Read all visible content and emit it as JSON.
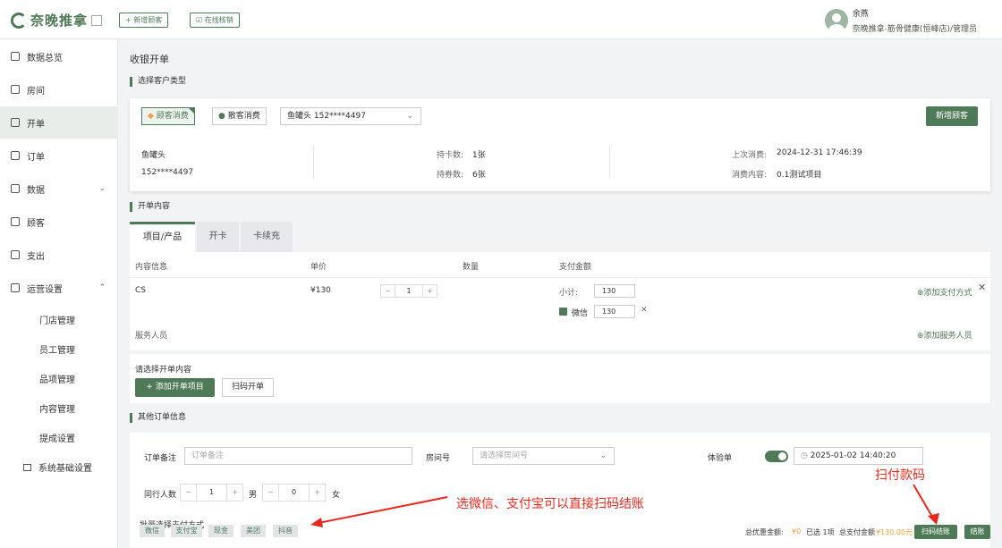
{
  "brand": {
    "name": "奈晚推拿"
  },
  "topbar": {
    "new_customer": "+ 新增顾客",
    "verify": "☑ 在线核销"
  },
  "user": {
    "name": "余燕",
    "store_role": "奈晚推拿-筋骨健康(恒峰店)/管理员"
  },
  "sidebar": {
    "items": [
      {
        "label": "数据总览"
      },
      {
        "label": "房间"
      },
      {
        "label": "开单"
      },
      {
        "label": "订单"
      },
      {
        "label": "数据"
      },
      {
        "label": "顾客"
      },
      {
        "label": "支出"
      },
      {
        "label": "运营设置"
      }
    ],
    "sub_items": [
      {
        "label": "门店管理"
      },
      {
        "label": "员工管理"
      },
      {
        "label": "品项管理"
      },
      {
        "label": "内容管理"
      },
      {
        "label": "提成设置"
      },
      {
        "label": "系统基础设置"
      }
    ]
  },
  "page": {
    "title": "收银开单"
  },
  "customer_section": {
    "title": "选择客户类型",
    "type_member": "顾客消费",
    "type_walkin": "散客消费",
    "selected_customer": "鱼罐头 152****4497",
    "new_button": "新增顾客",
    "name": "鱼罐头",
    "phone": "152****4497",
    "cards_label": "持卡数:",
    "cards_value": "1张",
    "coupons_label": "持券数:",
    "coupons_value": "6张",
    "last_label": "上次消费:",
    "last_value": "2024-12-31 17:46:39",
    "content_label": "消费内容:",
    "content_value": "0.1测试项目"
  },
  "order_section": {
    "title": "开单内容",
    "tabs": [
      "项目/产品",
      "开卡",
      "卡续充"
    ],
    "headers": [
      "内容信息",
      "单价",
      "数量",
      "支付金额"
    ],
    "row": {
      "name": "CS",
      "price": "¥130",
      "qty": "1",
      "subtotal_label": "小计:",
      "subtotal": "130",
      "pay_method": "微信",
      "pay_amount": "130",
      "add_payment": "⊕添加支付方式"
    },
    "staff_label": "服务人员",
    "add_staff": "⊕添加服务人员"
  },
  "add_section": {
    "title": "请选择开单内容",
    "add_item": "+ 添加开单项目",
    "scan_order": "扫码开单"
  },
  "other_section": {
    "title": "其他订单信息",
    "remark_label": "订单备注",
    "remark_placeholder": "订单备注",
    "room_label": "房间号",
    "room_placeholder": "请选择房间号",
    "trial_label": "体验单",
    "datetime": "2025-01-02 14:40:20",
    "companions_label": "同行人数",
    "male_count": "1",
    "male_label": "男",
    "female_count": "0",
    "female_label": "女",
    "batch_pay_label": "批量选择支付方式",
    "pay_options": [
      "微信",
      "支付宝",
      "现金",
      "美团",
      "抖音"
    ]
  },
  "footer": {
    "discount_label": "总优惠金额:",
    "discount_value": "¥0",
    "selected": "已选 1项",
    "total_label": "总支付金额",
    "total_value": "¥130.00元",
    "scan_pay": "扫码结账",
    "checkout": "结账"
  },
  "annotations": {
    "scan_code": "扫付款码",
    "tip": "选微信、支付宝可以直接扫码结账"
  }
}
